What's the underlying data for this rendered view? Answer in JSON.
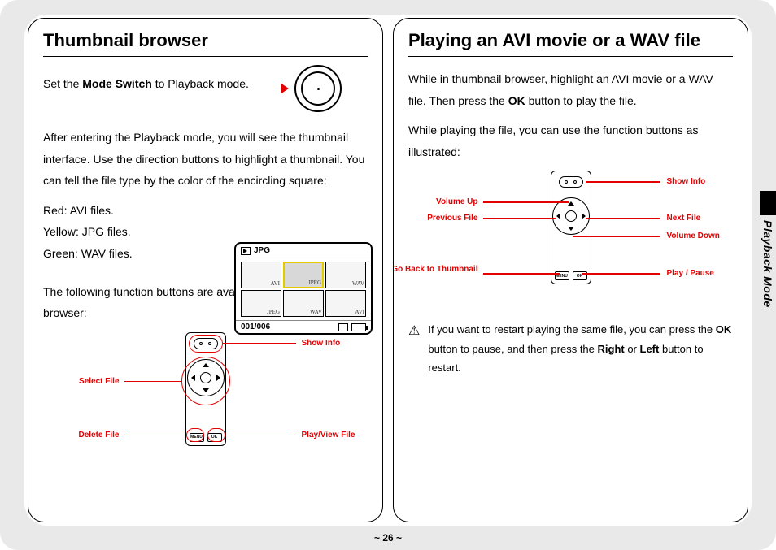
{
  "page_number": "~ 26 ~",
  "side_tab": "Playback Mode",
  "left": {
    "title": "Thumbnail browser",
    "intro_a": "Set the ",
    "intro_b": "Mode Switch",
    "intro_c": " to Playback mode.",
    "para2": "After entering the Playback mode, you will see the thumbnail interface. Use the direction buttons to highlight a thumbnail. You can tell the file type by the color of the encircling square:",
    "red_line": "Red: AVI files.",
    "yellow_line": "Yellow: JPG files.",
    "green_line": "Green: WAV files.",
    "para3": "The following function buttons are available in the thumbnail browser:",
    "lcd": {
      "top_label": "JPG",
      "counter": "001/006",
      "cells": [
        "AVI",
        "JPEG",
        "WAV",
        "JPEG",
        "WAV",
        "AVI"
      ]
    },
    "remote_labels": {
      "show_info": "Show Info",
      "select_file": "Select File",
      "delete_file": "Delete File",
      "play_view": "Play/View File",
      "menu": "MENU",
      "ok": "OK"
    }
  },
  "right": {
    "title": "Playing an AVI movie or a WAV file",
    "para1a": "While in thumbnail browser, highlight an AVI movie or a WAV file. Then press the ",
    "para1b": "OK",
    "para1c": " button to play the file.",
    "para2": "While playing the file, you can use the function buttons as illustrated:",
    "remote_labels": {
      "show_info": "Show Info",
      "volume_up": "Volume Up",
      "previous_file": "Previous File",
      "next_file": "Next File",
      "volume_down": "Volume Down",
      "go_back": "Go Back to Thumbnail",
      "play_pause": "Play / Pause",
      "menu": "MENU",
      "ok": "OK"
    },
    "note_a": "If you want to restart playing the same file, you can press the ",
    "note_b": "OK",
    "note_c": " button to pause, and then press the ",
    "note_d": "Right",
    "note_e": " or ",
    "note_f": "Left",
    "note_g": " button to restart."
  }
}
